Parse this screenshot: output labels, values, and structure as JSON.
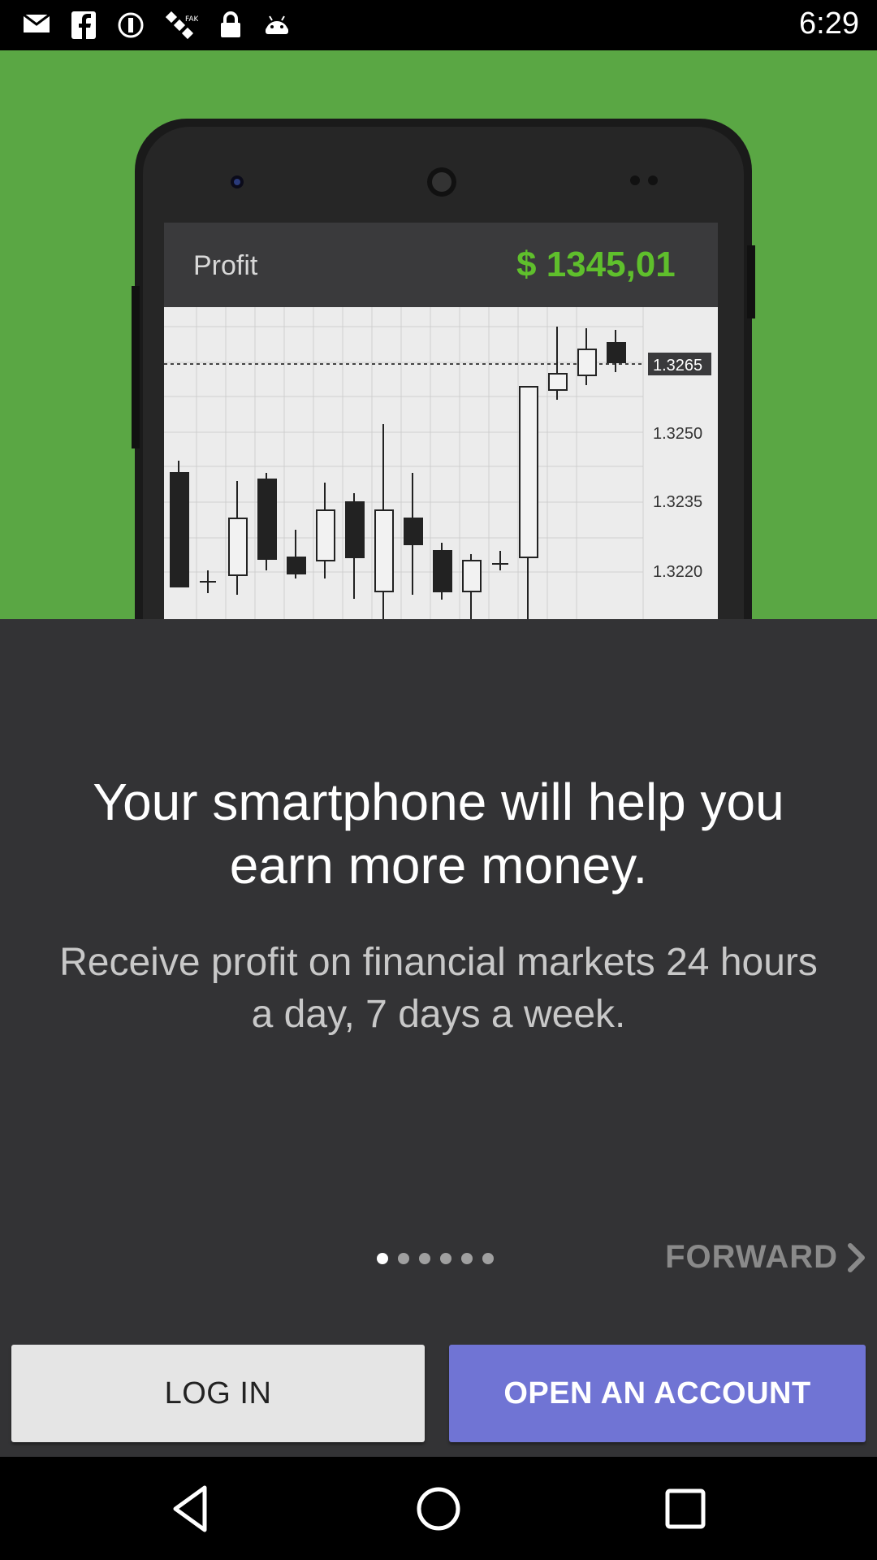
{
  "status_bar": {
    "time": "6:29",
    "icons": [
      "gmail-icon",
      "facebook-icon",
      "cloud-icon",
      "satellite-icon",
      "lock-icon",
      "android-icon"
    ]
  },
  "hero": {
    "phone_screen": {
      "label": "Profit",
      "amount": "$ 1345,01",
      "price_levels": [
        "1.3265",
        "1.3250",
        "1.3235",
        "1.3220"
      ]
    },
    "background_color": "#5aa744"
  },
  "headline": "Your smartphone will help you earn more money.",
  "subtext": "Receive profit on financial  markets 24 hours a day, 7 days a week.",
  "pager": {
    "total": 6,
    "active": 1
  },
  "forward_label": "FORWARD",
  "buttons": {
    "login": "LOG IN",
    "open_account": "OPEN AN ACCOUNT"
  },
  "colors": {
    "accent": "#7074d4",
    "amount": "#5fbf2c",
    "background": "#333335"
  }
}
